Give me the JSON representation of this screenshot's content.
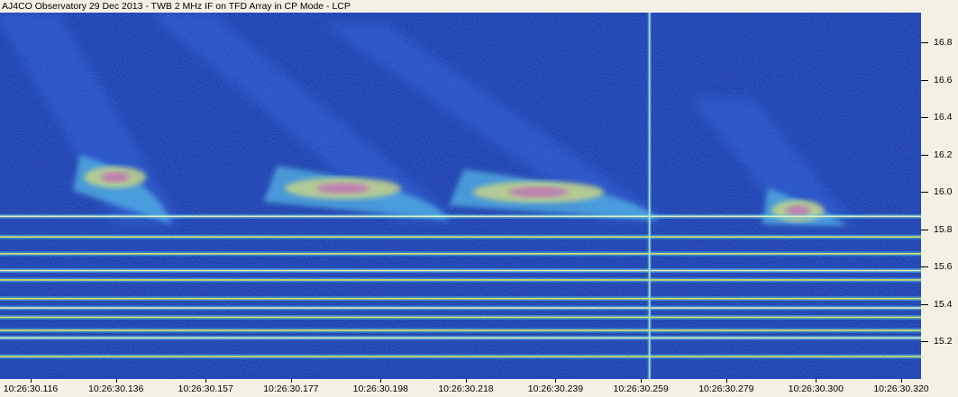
{
  "window": {
    "title": "AJ4CO Observatory 29 Dec 2013 - TWB 2 MHz IF on TFD Array in CP Mode - LCP"
  },
  "chart_data": {
    "type": "heatmap",
    "title": "AJ4CO Observatory 29 Dec 2013 - TWB 2 MHz IF on TFD Array in CP Mode - LCP",
    "xlabel": "",
    "ylabel": "",
    "ylim": [
      15.0,
      16.96
    ],
    "x_ticks": [
      "10:26:30.116",
      "10:26:30.136",
      "10:26:30.157",
      "10:26:30.177",
      "10:26:30.198",
      "10:26:30.218",
      "10:26:30.239",
      "10:26:30.259",
      "10:26:30.279",
      "10:26:30.300",
      "10:26:30.320"
    ],
    "y_ticks": [
      15.2,
      15.4,
      15.6,
      15.8,
      16.0,
      16.2,
      16.4,
      16.6,
      16.8
    ],
    "colors": {
      "background": "#0d2a9e",
      "low": "#1f4fd0",
      "mid": "#4fc3e0",
      "high": "#e8e860",
      "peak": "#e05aa0"
    },
    "features": {
      "bursts": [
        {
          "t_start": "10:26:30.116",
          "t_end": "10:26:30.149",
          "f_top": 16.96,
          "f_bottom": 15.83,
          "peak_f": 16.08
        },
        {
          "t_start": "10:26:30.152",
          "t_end": "10:26:30.214",
          "f_top": 16.96,
          "f_bottom": 15.85,
          "peak_f": 16.02
        },
        {
          "t_start": "10:26:30.193",
          "t_end": "10:26:30.263",
          "f_top": 16.9,
          "f_bottom": 15.85,
          "peak_f": 16.0
        },
        {
          "t_start": "10:26:30.279",
          "t_end": "10:26:30.307",
          "f_top": 16.5,
          "f_bottom": 15.82,
          "peak_f": 15.9
        }
      ],
      "interference_lines_mhz": [
        15.87,
        15.76,
        15.67,
        15.58,
        15.53,
        15.43,
        15.38,
        15.33,
        15.26,
        15.22,
        15.12
      ],
      "vertical_line_time": "10:26:30.261"
    }
  }
}
